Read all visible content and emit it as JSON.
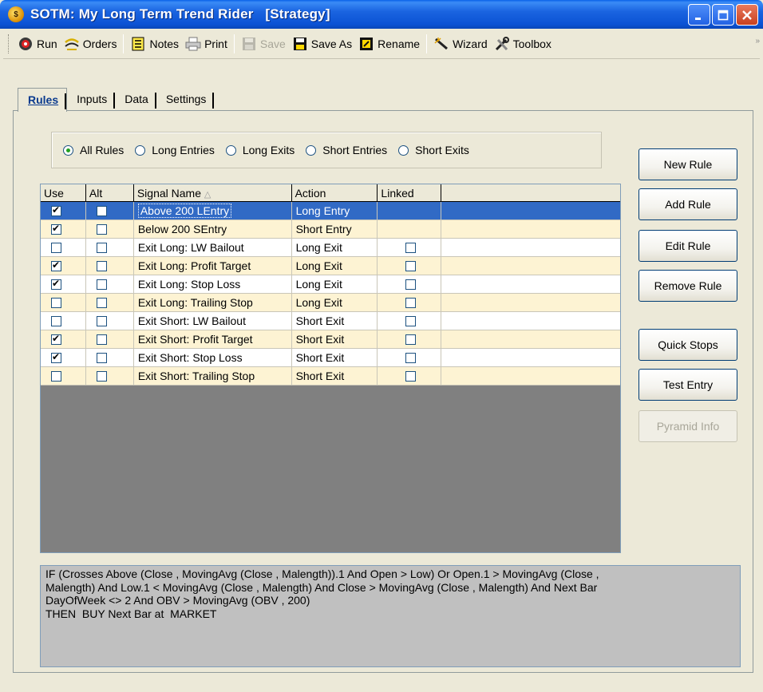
{
  "window": {
    "title": "SOTM: My Long Term Trend Rider   [Strategy]"
  },
  "toolbar": {
    "run": "Run",
    "orders": "Orders",
    "notes": "Notes",
    "print": "Print",
    "save": "Save",
    "save_as": "Save As",
    "rename": "Rename",
    "wizard": "Wizard",
    "toolbox": "Toolbox",
    "more": "»"
  },
  "tabs": [
    "Rules",
    "Inputs",
    "Data",
    "Settings"
  ],
  "filters": {
    "options": [
      "All Rules",
      "Long Entries",
      "Long Exits",
      "Short Entries",
      "Short Exits"
    ],
    "selected": "All Rules"
  },
  "grid": {
    "columns": [
      "Use",
      "Alt",
      "Signal Name",
      "Action",
      "Linked"
    ],
    "sort_indicator": "△",
    "rows": [
      {
        "use": true,
        "alt": false,
        "name": "Above 200 LEntry",
        "action": "Long Entry",
        "linked": null
      },
      {
        "use": true,
        "alt": false,
        "name": "Below 200 SEntry",
        "action": "Short Entry",
        "linked": null
      },
      {
        "use": false,
        "alt": false,
        "name": "Exit Long: LW Bailout",
        "action": "Long Exit",
        "linked": false
      },
      {
        "use": true,
        "alt": false,
        "name": "Exit Long: Profit Target",
        "action": "Long Exit",
        "linked": false
      },
      {
        "use": true,
        "alt": false,
        "name": "Exit Long: Stop Loss",
        "action": "Long Exit",
        "linked": false
      },
      {
        "use": false,
        "alt": false,
        "name": "Exit Long: Trailing Stop",
        "action": "Long Exit",
        "linked": false
      },
      {
        "use": false,
        "alt": false,
        "name": "Exit Short: LW Bailout",
        "action": "Short Exit",
        "linked": false
      },
      {
        "use": true,
        "alt": false,
        "name": "Exit Short: Profit Target",
        "action": "Short Exit",
        "linked": false
      },
      {
        "use": true,
        "alt": false,
        "name": "Exit Short: Stop Loss",
        "action": "Short Exit",
        "linked": false
      },
      {
        "use": false,
        "alt": false,
        "name": "Exit Short: Trailing Stop",
        "action": "Short Exit",
        "linked": false
      }
    ]
  },
  "buttons": {
    "new_rule": "New Rule",
    "add_rule": "Add Rule",
    "edit_rule": "Edit Rule",
    "remove_rule": "Remove Rule",
    "quick_stops": "Quick Stops",
    "test_entry": "Test Entry",
    "pyramid_info": "Pyramid Info"
  },
  "rule_text": {
    "line1": "IF (Crosses Above (Close , MovingAvg (Close , Malength)).1 And Open > Low) Or Open.1 > MovingAvg (Close ,",
    "line2": "Malength) And Low.1 < MovingAvg (Close , Malength) And Close > MovingAvg (Close , Malength) And Next Bar",
    "line3": "DayOfWeek <> 2 And OBV > MovingAvg (OBV , 200)",
    "line4": "THEN  BUY Next Bar at  MARKET"
  }
}
